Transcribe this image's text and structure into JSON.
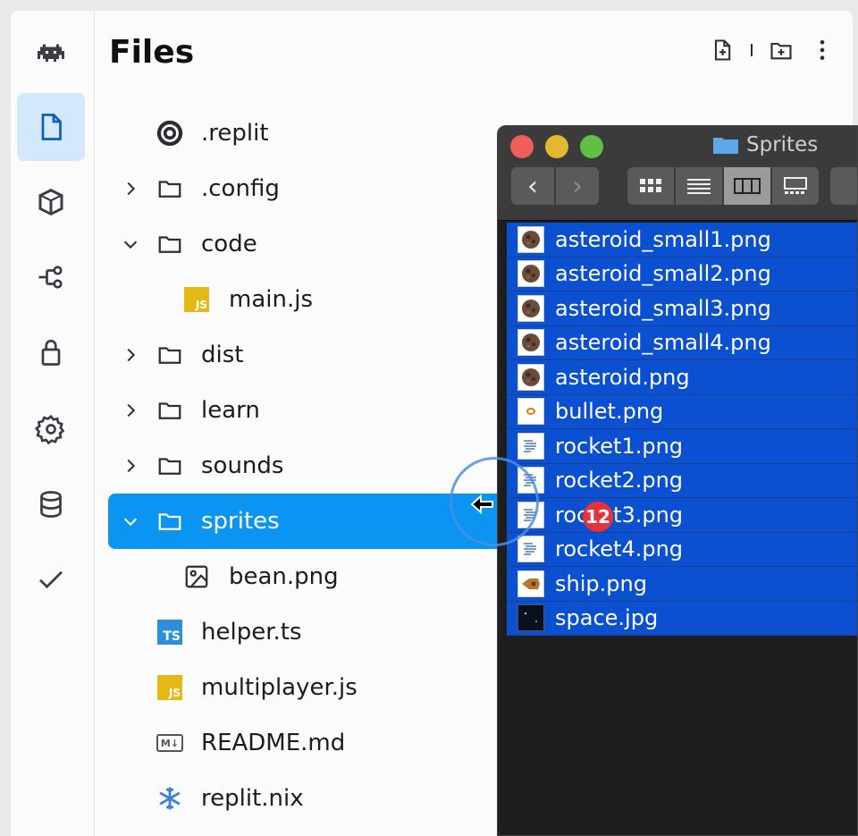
{
  "sidebar": {
    "icons": [
      "invader-logo-icon",
      "file-icon",
      "package-icon",
      "version-control-icon",
      "lock-icon",
      "gear-icon",
      "database-icon",
      "check-icon"
    ]
  },
  "files_panel": {
    "title": "Files",
    "actions": [
      "new-file-icon",
      "new-folder-icon",
      "more-options-icon"
    ],
    "items": [
      {
        "label": ".replit",
        "type": "replit-config"
      },
      {
        "label": ".config",
        "type": "folder",
        "expanded": false
      },
      {
        "label": "code",
        "type": "folder",
        "expanded": true
      },
      {
        "label": "main.js",
        "type": "js",
        "badge": "JS"
      },
      {
        "label": "dist",
        "type": "folder",
        "expanded": false
      },
      {
        "label": "learn",
        "type": "folder",
        "expanded": false
      },
      {
        "label": "sounds",
        "type": "folder",
        "expanded": false
      },
      {
        "label": "sprites",
        "type": "folder",
        "expanded": true,
        "selected": true
      },
      {
        "label": "bean.png",
        "type": "image"
      },
      {
        "label": "helper.ts",
        "type": "ts",
        "badge": "TS"
      },
      {
        "label": "multiplayer.js",
        "type": "js",
        "badge": "JS"
      },
      {
        "label": "README.md",
        "type": "md",
        "badge": "M↓"
      },
      {
        "label": "replit.nix",
        "type": "nix"
      }
    ]
  },
  "finder": {
    "title": "Sprites",
    "files": [
      {
        "name": "asteroid_small1.png",
        "thumb": "asteroid"
      },
      {
        "name": "asteroid_small2.png",
        "thumb": "asteroid"
      },
      {
        "name": "asteroid_small3.png",
        "thumb": "asteroid"
      },
      {
        "name": "asteroid_small4.png",
        "thumb": "asteroid"
      },
      {
        "name": "asteroid.png",
        "thumb": "asteroid"
      },
      {
        "name": "bullet.png",
        "thumb": "bullet"
      },
      {
        "name": "rocket1.png",
        "thumb": "rocket"
      },
      {
        "name": "rocket2.png",
        "thumb": "rocket"
      },
      {
        "name": "rocket3.png",
        "thumb": "rocket"
      },
      {
        "name": "rocket4.png",
        "thumb": "rocket"
      },
      {
        "name": "ship.png",
        "thumb": "ship"
      },
      {
        "name": "space.jpg",
        "thumb": "space"
      }
    ],
    "drag_count": "12"
  },
  "colors": {
    "selected_row": "#0b94f2",
    "finder_selection": "#0a50d0",
    "active_rail": "#d4e8fc",
    "drag_badge": "#e8323b"
  }
}
